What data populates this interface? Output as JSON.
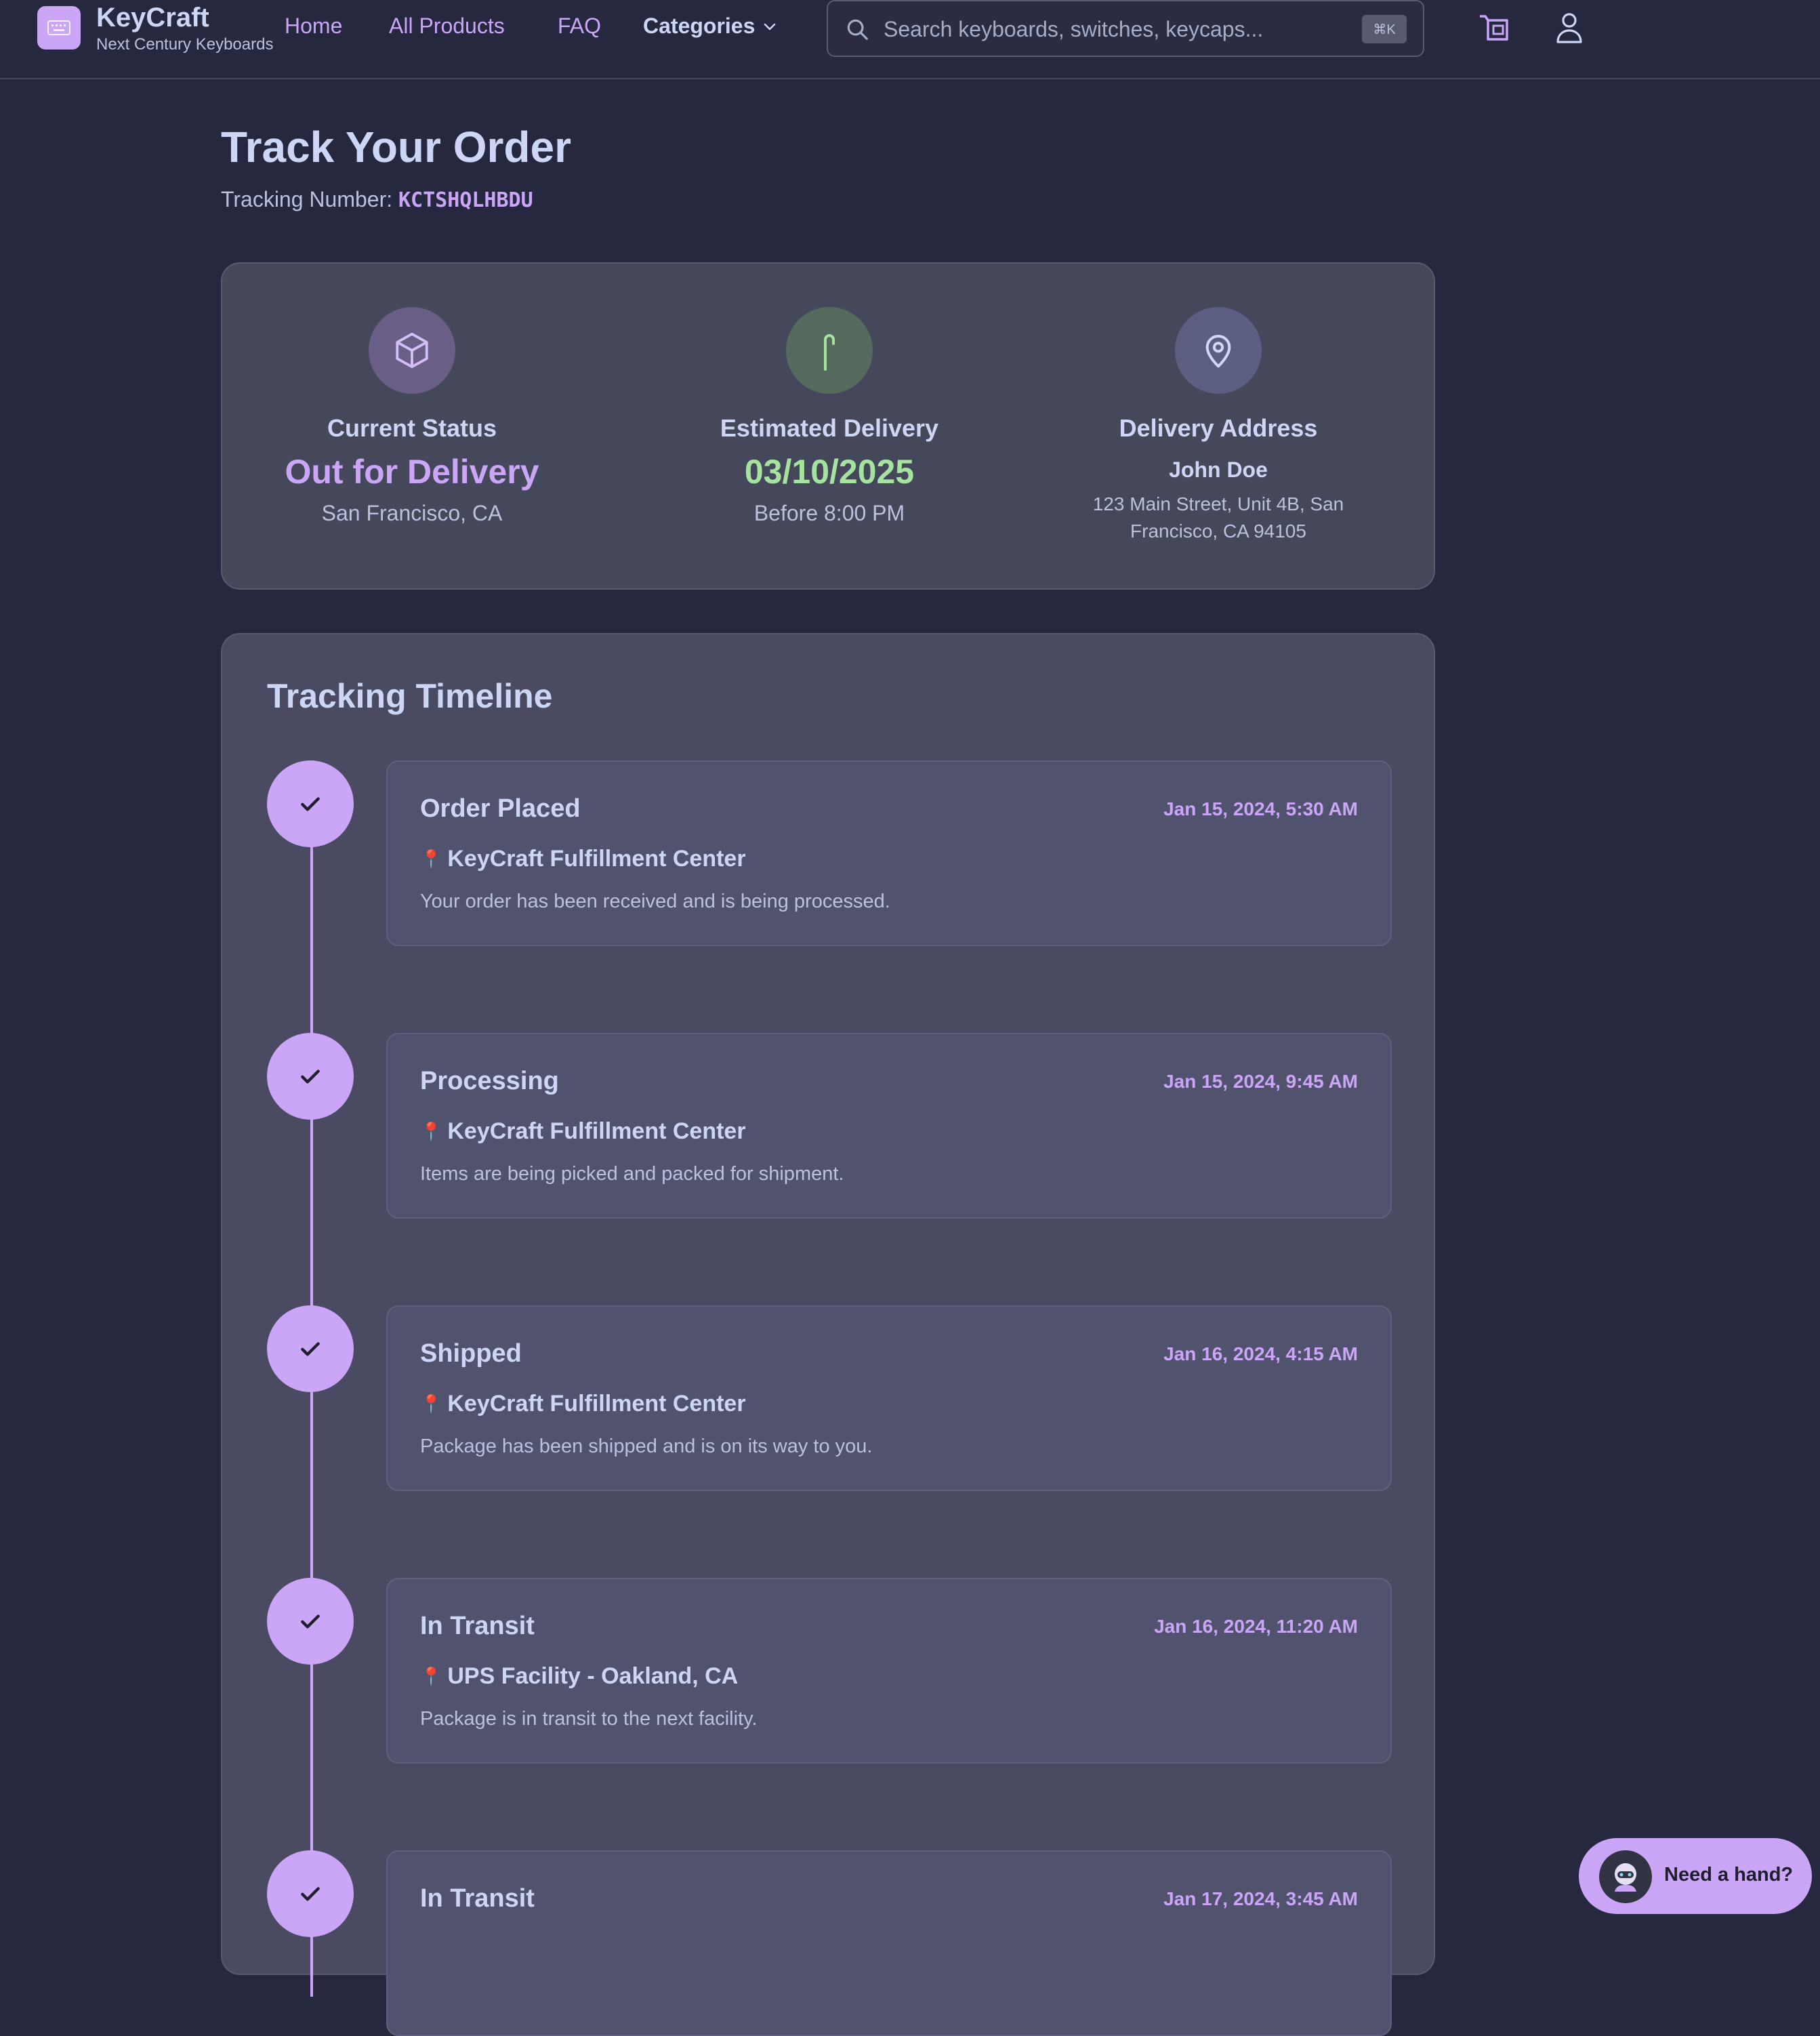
{
  "header": {
    "brand": "KeyCraft",
    "tagline": "Next Century Keyboards",
    "nav": {
      "home": "Home",
      "all_products": "All Products",
      "faq": "FAQ",
      "categories": "Categories"
    },
    "search": {
      "placeholder": "Search keyboards, switches, keycaps...",
      "shortcut": "⌘K"
    },
    "icons": [
      "keyboard-icon",
      "search-icon",
      "cart-icon",
      "user-icon",
      "chevron-down-icon"
    ]
  },
  "page": {
    "title": "Track Your Order",
    "tracking_label": "Tracking Number:",
    "tracking_number": "KCTSHQLHBDU"
  },
  "summary": {
    "status": {
      "label": "Current Status",
      "value": "Out for Delivery",
      "sub": "San Francisco, CA",
      "icon": "package-icon"
    },
    "delivery": {
      "label": "Estimated Delivery",
      "value": "03/10/2025",
      "sub": "Before 8:00 PM",
      "icon": "cane-icon"
    },
    "address": {
      "label": "Delivery Address",
      "name": "John Doe",
      "line": "123 Main Street, Unit 4B, San Francisco, CA 94105",
      "icon": "map-pin-icon"
    }
  },
  "timeline": {
    "title": "Tracking Timeline",
    "events": [
      {
        "title": "Order Placed",
        "time": "Jan 15, 2024, 5:30 AM",
        "location": "KeyCraft Fulfillment Center",
        "description": "Your order has been received and is being processed."
      },
      {
        "title": "Processing",
        "time": "Jan 15, 2024, 9:45 AM",
        "location": "KeyCraft Fulfillment Center",
        "description": "Items are being picked and packed for shipment."
      },
      {
        "title": "Shipped",
        "time": "Jan 16, 2024, 4:15 AM",
        "location": "KeyCraft Fulfillment Center",
        "description": "Package has been shipped and is on its way to you."
      },
      {
        "title": "In Transit",
        "time": "Jan 16, 2024, 11:20 AM",
        "location": "UPS Facility - Oakland, CA",
        "description": "Package is in transit to the next facility."
      },
      {
        "title": "In Transit",
        "time": "Jan 17, 2024, 3:45 AM",
        "location": "",
        "description": ""
      }
    ]
  },
  "help": {
    "label": "Need a hand?"
  },
  "colors": {
    "background": "#262840",
    "card": "#45475a",
    "accent": "#cba6f7",
    "success": "#a6e3a1",
    "text": "#cdd6f4"
  }
}
